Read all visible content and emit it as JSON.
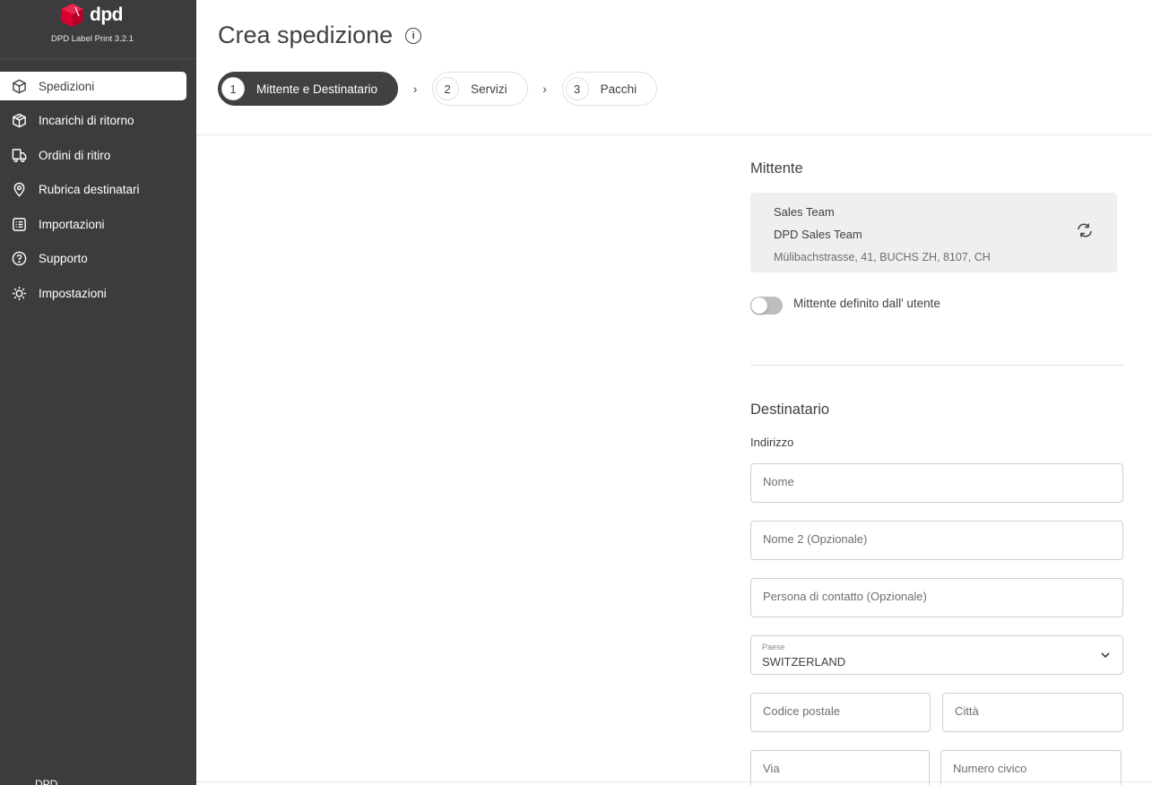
{
  "brand": {
    "logo_text": "dpd",
    "version": "DPD Label Print 3.2.1"
  },
  "sidebar": {
    "items": [
      {
        "label": "Spedizioni",
        "icon": "box-icon",
        "active": true
      },
      {
        "label": "Incarichi di ritorno",
        "icon": "box-return-icon",
        "active": false
      },
      {
        "label": "Ordini di ritiro",
        "icon": "truck-icon",
        "active": false
      },
      {
        "label": "Rubrica destinatari",
        "icon": "location-pin-icon",
        "active": false
      },
      {
        "label": "Importazioni",
        "icon": "list-icon",
        "active": false
      },
      {
        "label": "Supporto",
        "icon": "help-icon",
        "active": false
      },
      {
        "label": "Impostazioni",
        "icon": "gear-icon",
        "active": false
      }
    ],
    "footer": "DPD"
  },
  "page": {
    "title": "Crea spedizione",
    "info_icon": "i"
  },
  "steps": [
    {
      "num": "1",
      "label": "Mittente e Destinatario",
      "active": true
    },
    {
      "num": "2",
      "label": "Servizi",
      "active": false
    },
    {
      "num": "3",
      "label": "Pacchi",
      "active": false
    }
  ],
  "step_separator": "›",
  "sender": {
    "title": "Mittente",
    "name": "Sales Team",
    "company": "DPD Sales Team",
    "address": "Mülibachstrasse, 41, BUCHS ZH, 8107, CH",
    "toggle_label": "Mittente definito dall' utente",
    "toggle_on": false
  },
  "recipient": {
    "title": "Destinatario",
    "subtitle": "Indirizzo",
    "fields": {
      "name": "Nome",
      "name2": "Nome 2 (Opzionale)",
      "contact": "Persona di contatto (Opzionale)",
      "country_label": "Paese",
      "country_value": "SWITZERLAND",
      "postal_code": "Codice postale",
      "city": "Città",
      "street": "Via",
      "house_number": "Numero civico"
    }
  },
  "colors": {
    "sidebar_bg": "#3c3c3e",
    "brand_red": "#dc0032",
    "text": "#414042"
  }
}
